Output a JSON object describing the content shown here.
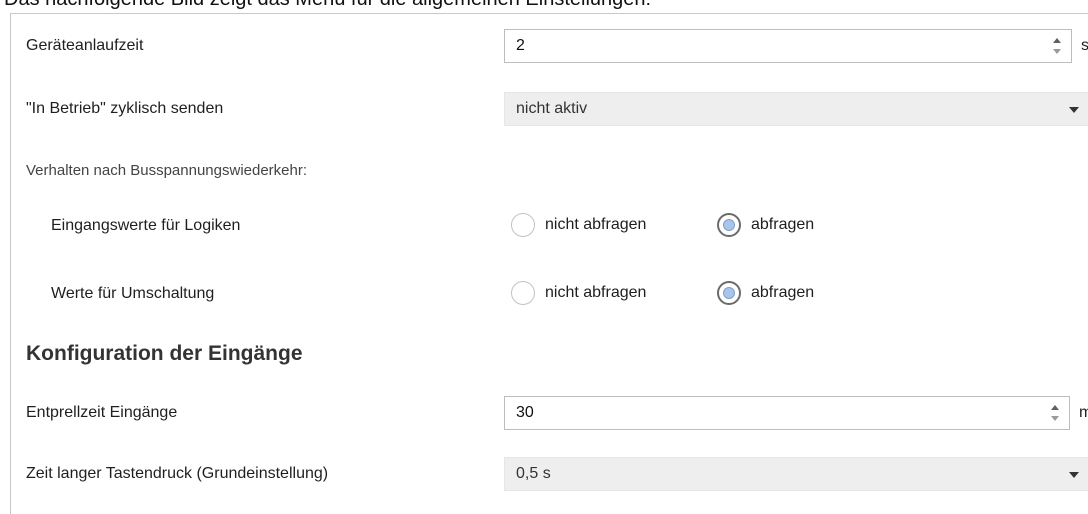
{
  "caption": "Das nachfolgende Bild zeigt das Menü für die allgemeinen Einstellungen:",
  "general": {
    "startup_time": {
      "label": "Geräteanlaufzeit",
      "value": "2",
      "unit": "s"
    },
    "cyclic_send": {
      "label": "\"In Betrieb\" zyklisch senden",
      "value": "nicht aktiv"
    },
    "bus_recovery_heading": "Verhalten nach Busspannungswiederkehr:",
    "logic_inputs": {
      "label": "Eingangswerte für Logiken",
      "options": [
        "nicht abfragen",
        "abfragen"
      ],
      "selected": "abfragen"
    },
    "switch_values": {
      "label": "Werte für Umschaltung",
      "options": [
        "nicht abfragen",
        "abfragen"
      ],
      "selected": "abfragen"
    }
  },
  "inputs_config": {
    "title": "Konfiguration der Eingänge",
    "debounce": {
      "label": "Entprellzeit Eingänge",
      "value": "30",
      "unit": "ms"
    },
    "long_press": {
      "label": "Zeit langer Tastendruck (Grundeinstellung)",
      "value": "0,5 s"
    }
  },
  "icons": {
    "spin_up": "chevron-up-icon",
    "spin_down": "chevron-down-icon",
    "dropdown": "caret-down-icon"
  }
}
